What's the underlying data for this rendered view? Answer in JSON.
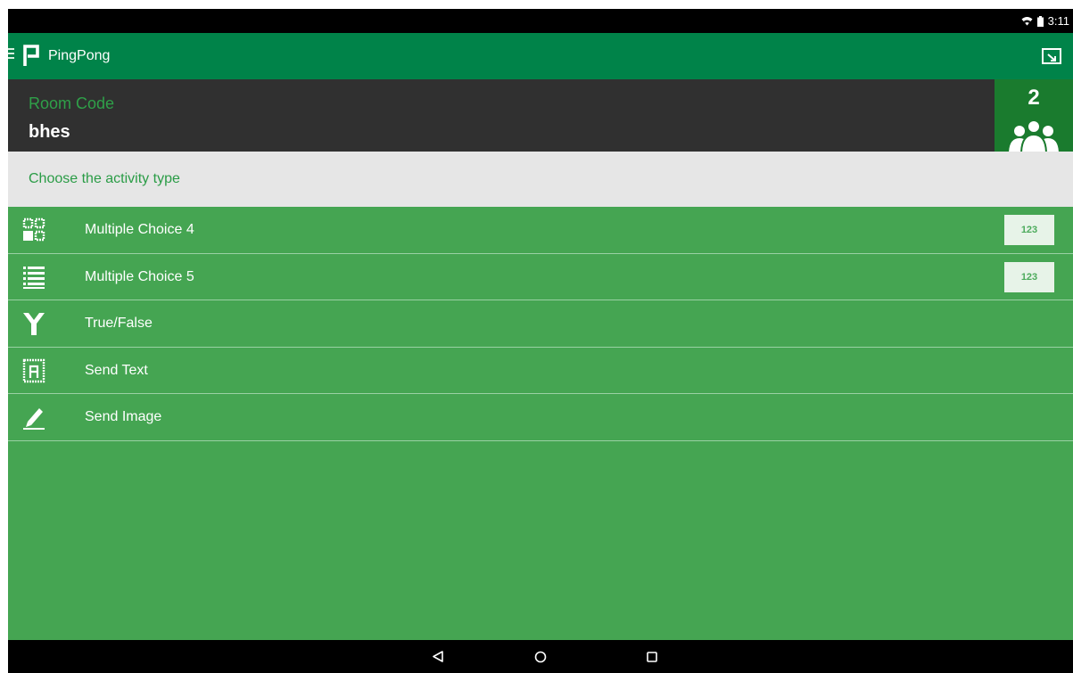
{
  "status_bar": {
    "time": "3:11",
    "wifi_icon": "wifi-icon",
    "battery_icon": "battery-icon"
  },
  "app_bar": {
    "title": "PingPong",
    "menu_icon": "menu-icon",
    "logo_icon": "pingpong-logo-icon",
    "cast_icon": "cast-icon"
  },
  "room": {
    "label": "Room Code",
    "code": "bhes",
    "participant_count": "2",
    "participants_icon": "people-icon"
  },
  "prompt": "Choose the activity type",
  "activities": [
    {
      "label": "Multiple Choice 4",
      "icon": "grid-icon",
      "badge": "123"
    },
    {
      "label": "Multiple Choice 5",
      "icon": "list-icon",
      "badge": "123"
    },
    {
      "label": "True/False",
      "icon": "fork-icon"
    },
    {
      "label": "Send Text",
      "icon": "letter-a-icon"
    },
    {
      "label": "Send Image",
      "icon": "pencil-icon"
    }
  ],
  "nav_bar": {
    "back_icon": "back-icon",
    "home_icon": "home-icon",
    "recents_icon": "recents-icon"
  },
  "colors": {
    "status_bar": "#000000",
    "app_bar": "#008349",
    "room_bar": "#303030",
    "room_label": "#2fa049",
    "participants_bg": "#1a7b2e",
    "prompt_bg": "#e6e6e6",
    "prompt_text": "#2a9c46",
    "list_bg": "#45a552",
    "badge_bg": "#e7f3e8",
    "badge_text": "#4cab5c",
    "nav_bar": "#000000"
  }
}
